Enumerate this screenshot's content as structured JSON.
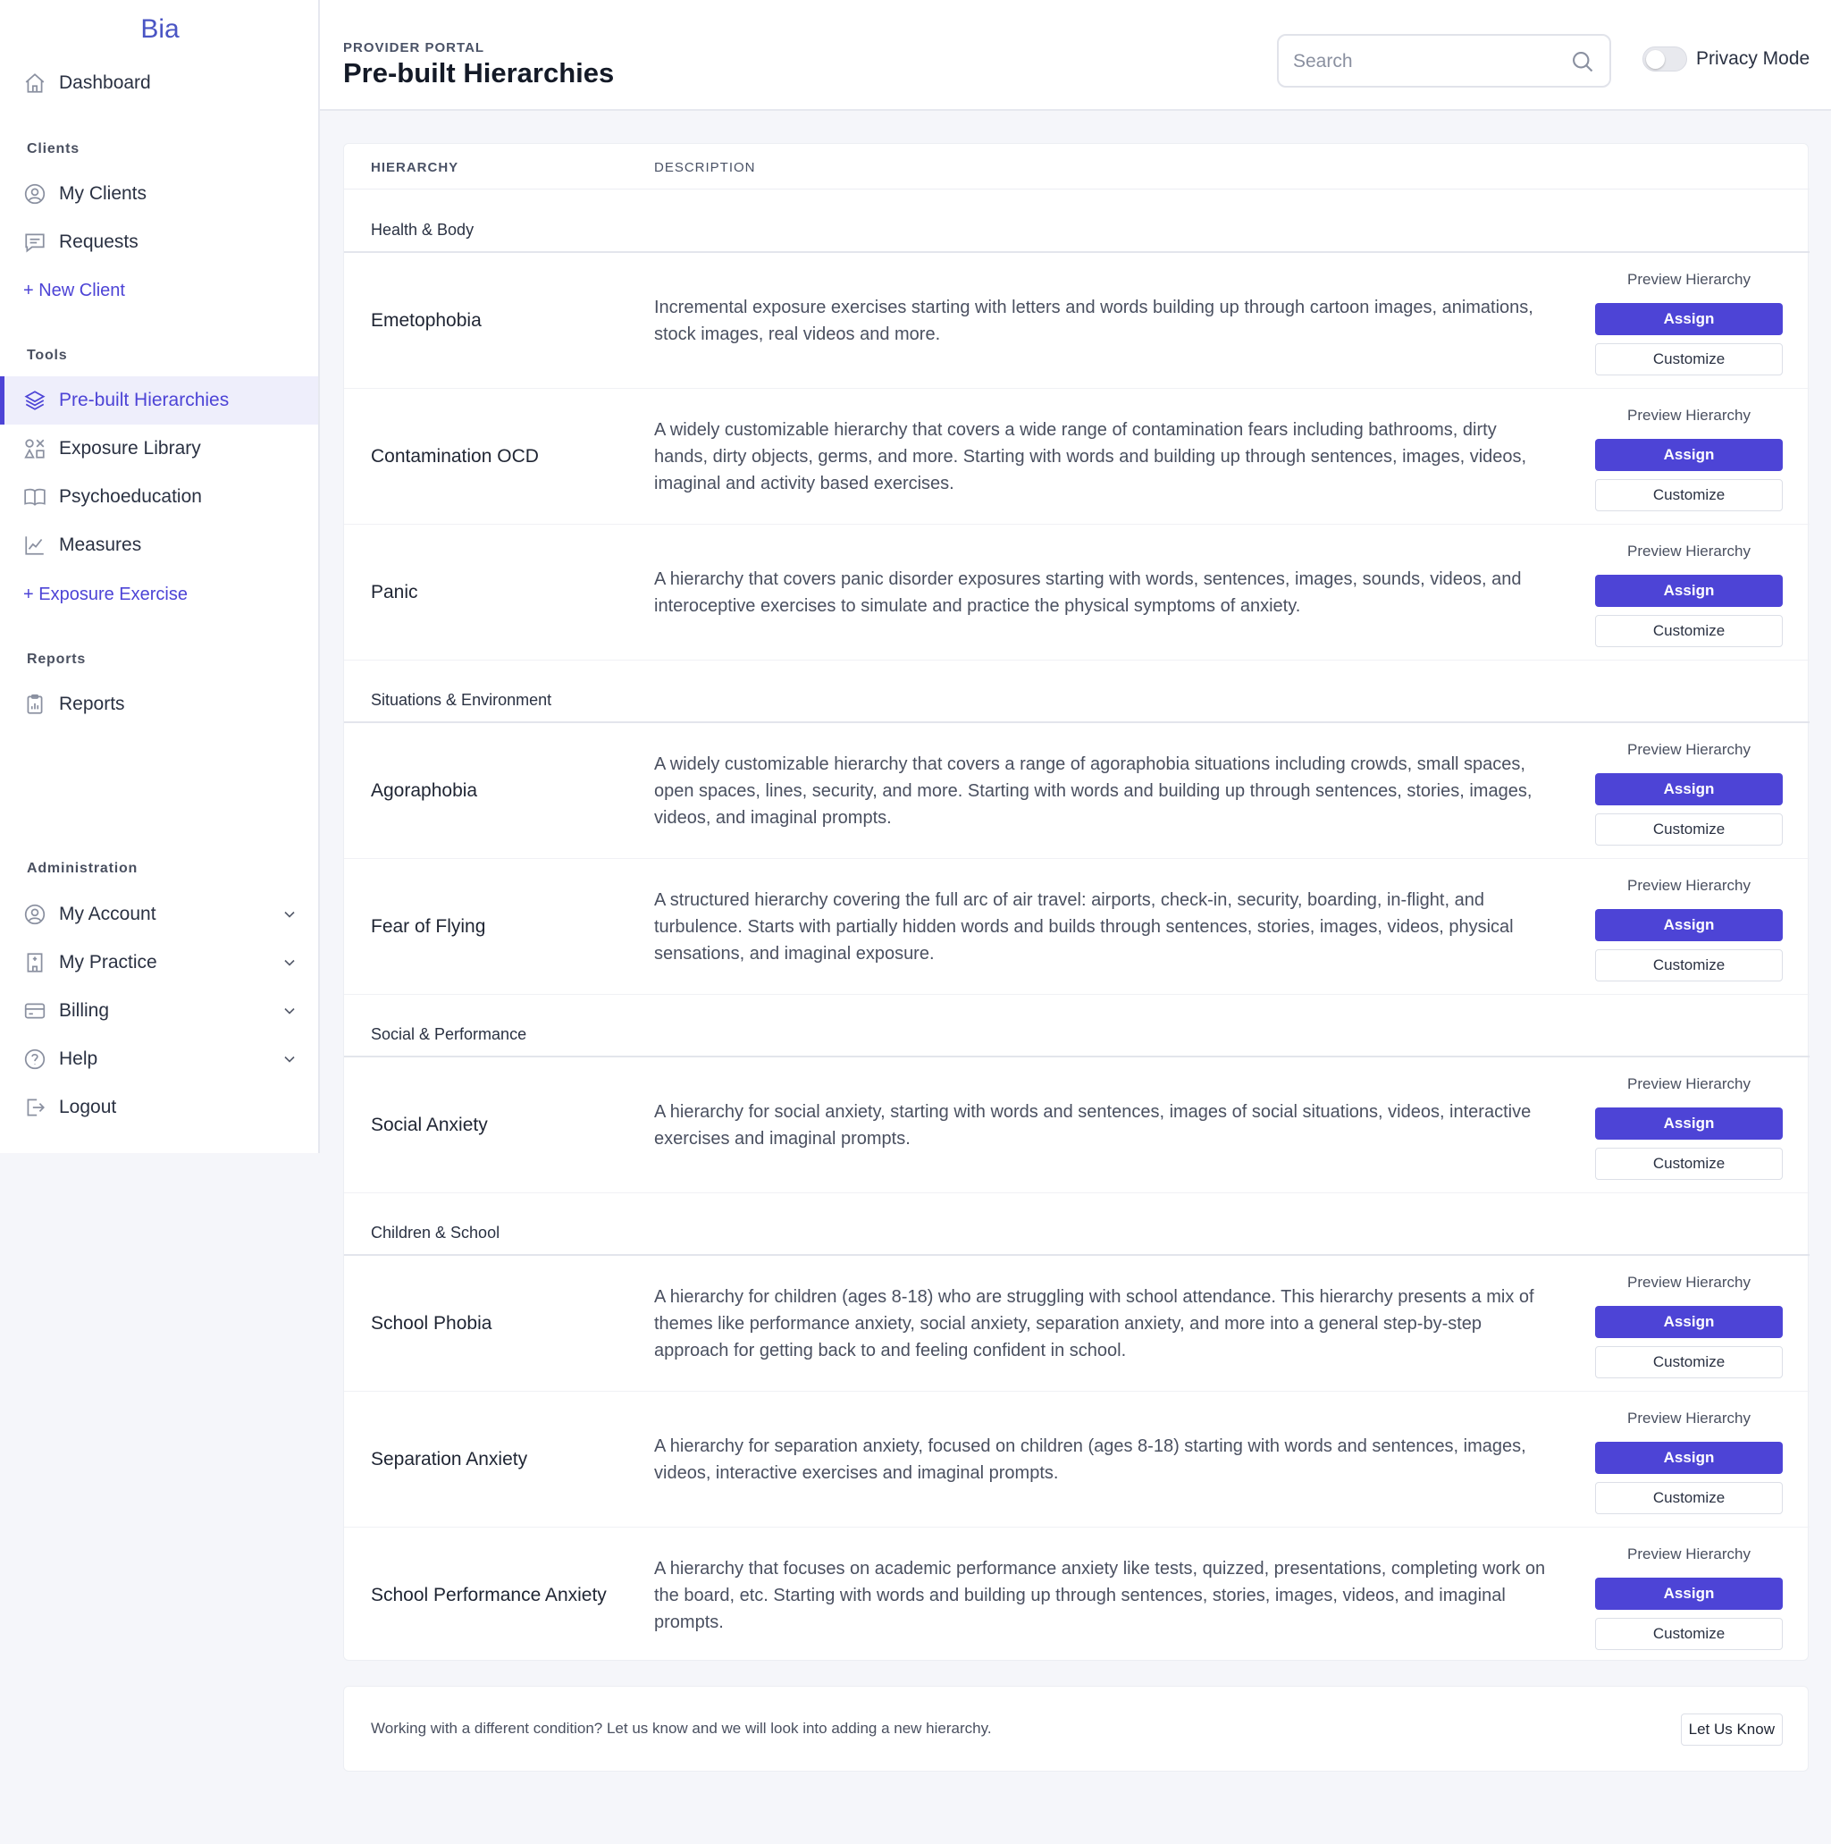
{
  "sidebar": {
    "brand": "Bia",
    "dashboard": "Dashboard",
    "sections": {
      "clients": "Clients",
      "tools": "Tools",
      "reports": "Reports",
      "administration": "Administration"
    },
    "clients_items": [
      "My Clients",
      "Requests"
    ],
    "new_client": "+ New Client",
    "tools_items": [
      "Pre-built Hierarchies",
      "Exposure Library",
      "Psychoeducation",
      "Measures"
    ],
    "new_exercise": "+ Exposure Exercise",
    "reports_items": [
      "Reports"
    ],
    "admin_items": [
      "My Account",
      "My Practice",
      "Billing",
      "Help",
      "Logout"
    ]
  },
  "header": {
    "portal_label": "PROVIDER PORTAL",
    "title": "Pre-built Hierarchies",
    "search_placeholder": "Search",
    "privacy_label": "Privacy Mode"
  },
  "table": {
    "col_hierarchy": "HIERARCHY",
    "col_description": "DESCRIPTION",
    "preview_label": "Preview Hierarchy",
    "assign_label": "Assign",
    "customize_label": "Customize",
    "groups": [
      {
        "label": "Health & Body",
        "rows": [
          {
            "name": "Emetophobia",
            "desc": "Incremental exposure exercises starting with letters and words building up through cartoon images, animations, stock images, real videos and more."
          },
          {
            "name": "Contamination OCD",
            "desc": "A widely customizable hierarchy that covers a wide range of contamination fears including bathrooms, dirty hands, dirty objects, germs, and more. Starting with words and building up through sentences, images, videos, imaginal and activity based exercises."
          },
          {
            "name": "Panic",
            "desc": "A hierarchy that covers panic disorder exposures starting with words, sentences, images, sounds, videos, and interoceptive exercises to simulate and practice the physical symptoms of anxiety."
          }
        ]
      },
      {
        "label": "Situations & Environment",
        "rows": [
          {
            "name": "Agoraphobia",
            "desc": "A widely customizable hierarchy that covers a range of agoraphobia situations including crowds, small spaces, open spaces, lines, security, and more. Starting with words and building up through sentences, stories, images, videos, and imaginal prompts."
          },
          {
            "name": "Fear of Flying",
            "desc": "A structured hierarchy covering the full arc of air travel: airports, check-in, security, boarding, in-flight, and turbulence. Starts with partially hidden words and builds through sentences, stories, images, videos, physical sensations, and imaginal exposure."
          }
        ]
      },
      {
        "label": "Social & Performance",
        "rows": [
          {
            "name": "Social Anxiety",
            "desc": "A hierarchy for social anxiety, starting with words and sentences, images of social situations, videos, interactive exercises and imaginal prompts."
          }
        ]
      },
      {
        "label": "Children & School",
        "rows": [
          {
            "name": "School Phobia",
            "desc": "A hierarchy for children (ages 8-18) who are struggling with school attendance. This hierarchy presents a mix of themes like performance anxiety, social anxiety, separation anxiety, and more into a general step-by-step approach for getting back to and feeling confident in school."
          },
          {
            "name": "Separation Anxiety",
            "desc": "A hierarchy for separation anxiety, focused on children (ages 8-18) starting with words and sentences, images, videos, interactive exercises and imaginal prompts."
          },
          {
            "name": "School Performance Anxiety",
            "desc": "A hierarchy that focuses on academic performance anxiety like tests, quizzed, presentations, completing work on the board, etc. Starting with words and building up through sentences, stories, images, videos, and imaginal prompts."
          }
        ]
      }
    ]
  },
  "footer": {
    "text": "Working with a different condition? Let us know and we will look into adding a new hierarchy.",
    "button": "Let Us Know"
  }
}
